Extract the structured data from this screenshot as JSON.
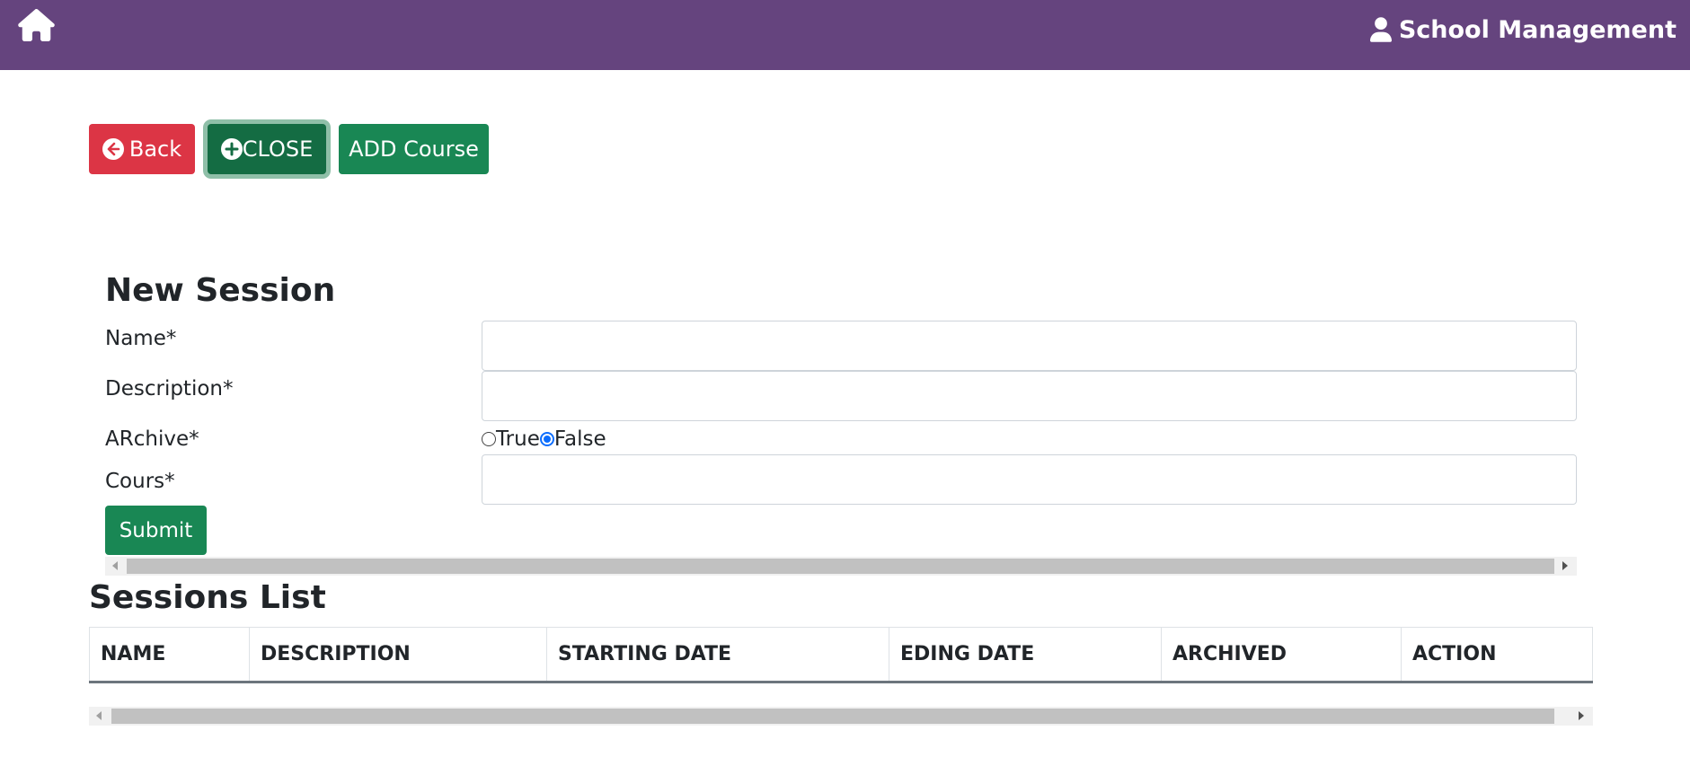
{
  "header": {
    "icon": "home-icon",
    "brand_icon": "user-icon",
    "title": "School Management",
    "background": "#65447e"
  },
  "toolbar": {
    "back_label": "Back",
    "close_label": "CLOSE",
    "add_course_label": "ADD Course"
  },
  "form": {
    "title": "New Session",
    "name_label": "Name*",
    "name_value": "",
    "description_label": "Description*",
    "description_value": "",
    "archive_label": "ARchive*",
    "archive_options": [
      "True",
      "False"
    ],
    "archive_selected": "False",
    "cours_label": "Cours*",
    "cours_value": "",
    "submit_label": "Submit"
  },
  "sessions": {
    "title": "Sessions List",
    "columns": [
      "NAME",
      "DESCRIPTION",
      "STARTING DATE",
      "EDING DATE",
      "ARCHIVED",
      "ACTION"
    ],
    "rows": []
  },
  "colors": {
    "danger": "#dc3545",
    "success": "#198754",
    "success_dark": "#146c43",
    "radio_accent": "#0d6efd"
  }
}
